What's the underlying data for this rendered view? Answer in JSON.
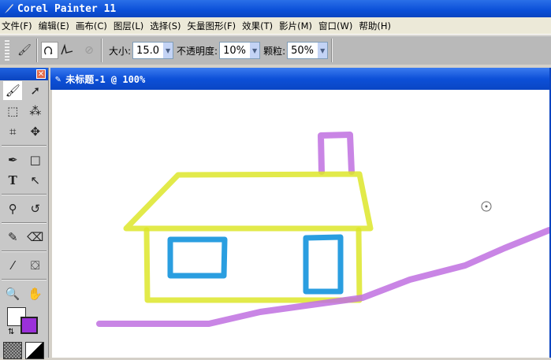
{
  "app": {
    "title": "Corel Painter 11"
  },
  "menu": [
    "文件(F)",
    "编辑(E)",
    "画布(C)",
    "图层(L)",
    "选择(S)",
    "矢量图形(F)",
    "效果(T)",
    "影片(M)",
    "窗口(W)",
    "帮助(H)"
  ],
  "toolbar": {
    "size_label": "大小:",
    "size_value": "15.0",
    "opacity_label": "不透明度:",
    "opacity_value": "10%",
    "grain_label": "颗粒:",
    "grain_value": "50%"
  },
  "document": {
    "title": "未标题-1 @ 100%"
  },
  "colors": {
    "main": "#ffffff",
    "additional": "#9b30d9"
  },
  "toolbox": {
    "close": "✕"
  }
}
